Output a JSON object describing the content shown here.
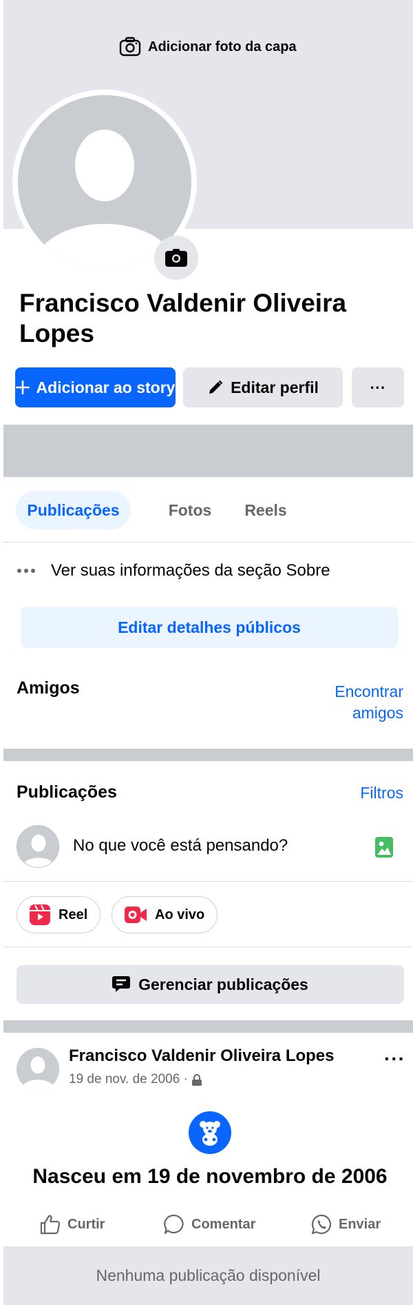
{
  "cover": {
    "add_cover_label": "Adicionar foto da capa"
  },
  "profile": {
    "name": "Francisco Valdenir Oliveira Lopes"
  },
  "actions": {
    "add_story": "Adicionar ao story",
    "edit_profile": "Editar perfil",
    "more": "···"
  },
  "tabs": [
    {
      "label": "Publicações",
      "active": true
    },
    {
      "label": "Fotos",
      "active": false
    },
    {
      "label": "Reels",
      "active": false
    }
  ],
  "about": {
    "see_info": "Ver suas informações da seção Sobre",
    "edit_public_details": "Editar detalhes públicos"
  },
  "friends": {
    "title": "Amigos",
    "find_line1": "Encontrar",
    "find_line2": "amigos"
  },
  "posts_section": {
    "title": "Publicações",
    "filters": "Filtros",
    "composer_placeholder": "No que você está pensando?",
    "reel_label": "Reel",
    "live_label": "Ao vivo",
    "manage_posts": "Gerenciar publicações"
  },
  "post": {
    "author": "Francisco Valdenir Oliveira Lopes",
    "date": "19 de nov. de 2006 ·",
    "more": "···",
    "life_event": "Nasceu em 19 de novembro de 2006",
    "like": "Curtir",
    "comment": "Comentar",
    "send": "Enviar"
  },
  "empty_state": "Nenhuma publicação disponível",
  "colors": {
    "accent": "#0866ff",
    "accent_light": "#ebf5ff",
    "gray_button": "#e4e6eb",
    "band": "#c9ccd1",
    "secondary_text": "#65676b",
    "reel_red": "#f02849",
    "photo_green": "#45bd62"
  }
}
